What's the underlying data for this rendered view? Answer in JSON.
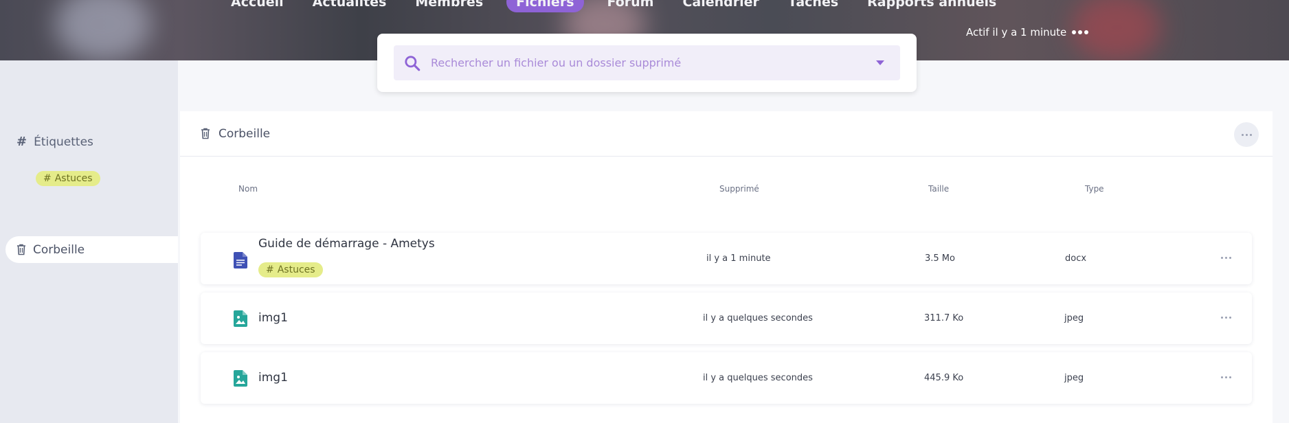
{
  "nav": {
    "items": [
      "Accueil",
      "Actualités",
      "Membres",
      "Fichiers",
      "Forum",
      "Calendrier",
      "Tâches",
      "Rapports annuels"
    ],
    "active_index": 3
  },
  "status": {
    "activity": "Actif il y a 1 minute"
  },
  "search": {
    "placeholder": "Rechercher un fichier ou un dossier supprimé"
  },
  "sidebar": {
    "tags_title": "Étiquettes",
    "tag": "Astuces",
    "trash_label": "Corbeille"
  },
  "main": {
    "title": "Corbeille",
    "columns": {
      "name": "Nom",
      "deleted": "Supprimé",
      "size": "Taille",
      "type": "Type"
    },
    "rows": [
      {
        "name": "Guide de démarrage - Ametys",
        "tag": "Astuces",
        "deleted": "il y a 1 minute",
        "size": "3.5 Mo",
        "type": "docx",
        "icon": "document-icon"
      },
      {
        "name": "img1",
        "deleted": "il y a quelques secondes",
        "size": "311.7 Ko",
        "type": "jpeg",
        "icon": "image-icon"
      },
      {
        "name": "img1",
        "deleted": "il y a quelques secondes",
        "size": "445.9 Ko",
        "type": "jpeg",
        "icon": "image-icon"
      }
    ]
  },
  "colors": {
    "accent": "#8e63d6",
    "tag_bg": "#e5ec8a",
    "doc_icon": "#3f51b5",
    "image_icon": "#26a69a"
  }
}
